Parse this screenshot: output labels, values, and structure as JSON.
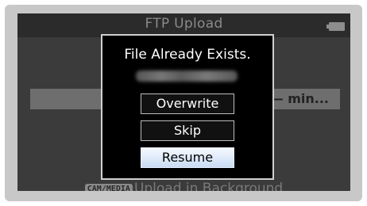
{
  "window": {
    "title": "FTP Upload",
    "battery_icon": "battery-icon"
  },
  "background": {
    "remain_text": "Remain: —— min..."
  },
  "dialog": {
    "title": "File Already Exists.",
    "filename_blurred": true,
    "buttons": [
      {
        "label": "Overwrite",
        "selected": false
      },
      {
        "label": "Skip",
        "selected": false
      },
      {
        "label": "Resume",
        "selected": true
      }
    ]
  },
  "footer": {
    "key_label": "CAM/MEDIA",
    "text": "Upload in Background"
  },
  "colors": {
    "screen_bg": "#3b3b3b",
    "dialog_bg": "#000000",
    "selected_button_bg": "#dce8f8"
  }
}
